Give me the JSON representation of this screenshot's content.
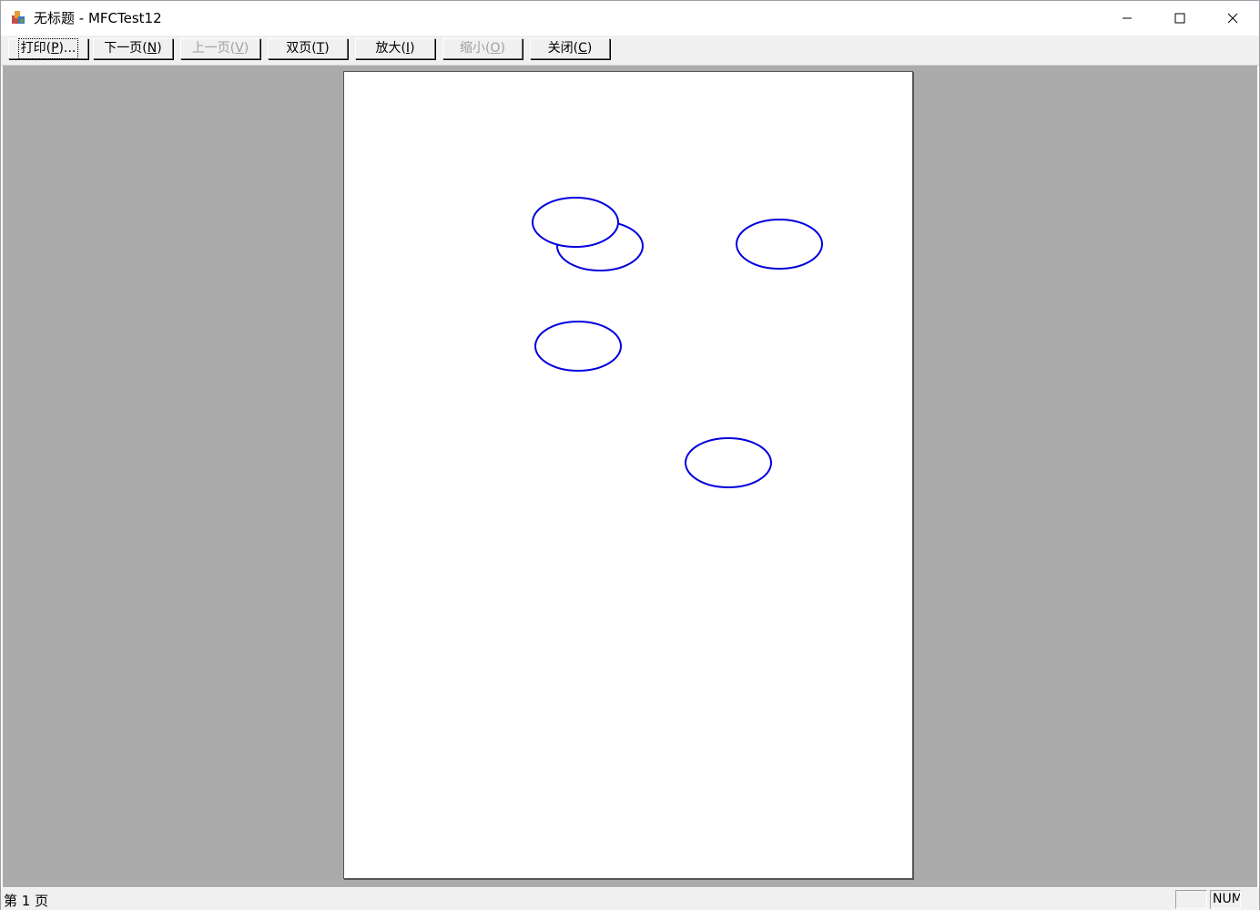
{
  "window": {
    "title": "无标题 - MFCTest12",
    "icon": "mfc-app-icon"
  },
  "caption_buttons": {
    "minimize": "minimize-icon",
    "maximize": "maximize-icon",
    "close": "close-icon"
  },
  "toolbar": {
    "buttons": [
      {
        "label": "打印",
        "mnemonic": "P",
        "suffix": "...",
        "enabled": true
      },
      {
        "label": "下一页",
        "mnemonic": "N",
        "suffix": "",
        "enabled": true
      },
      {
        "label": "上一页",
        "mnemonic": "V",
        "suffix": "",
        "enabled": false
      },
      {
        "label": "双页",
        "mnemonic": "T",
        "suffix": "",
        "enabled": true
      },
      {
        "label": "放大",
        "mnemonic": "I",
        "suffix": "",
        "enabled": true
      },
      {
        "label": "缩小",
        "mnemonic": "O",
        "suffix": "",
        "enabled": false
      },
      {
        "label": "关闭",
        "mnemonic": "C",
        "suffix": "",
        "enabled": true
      }
    ]
  },
  "preview": {
    "ellipse_count": 5,
    "ellipse_color": "#0000dd",
    "workspace_color": "#ababab"
  },
  "statusbar": {
    "text": "第 1 页",
    "panes": [
      "",
      "NUM"
    ]
  }
}
